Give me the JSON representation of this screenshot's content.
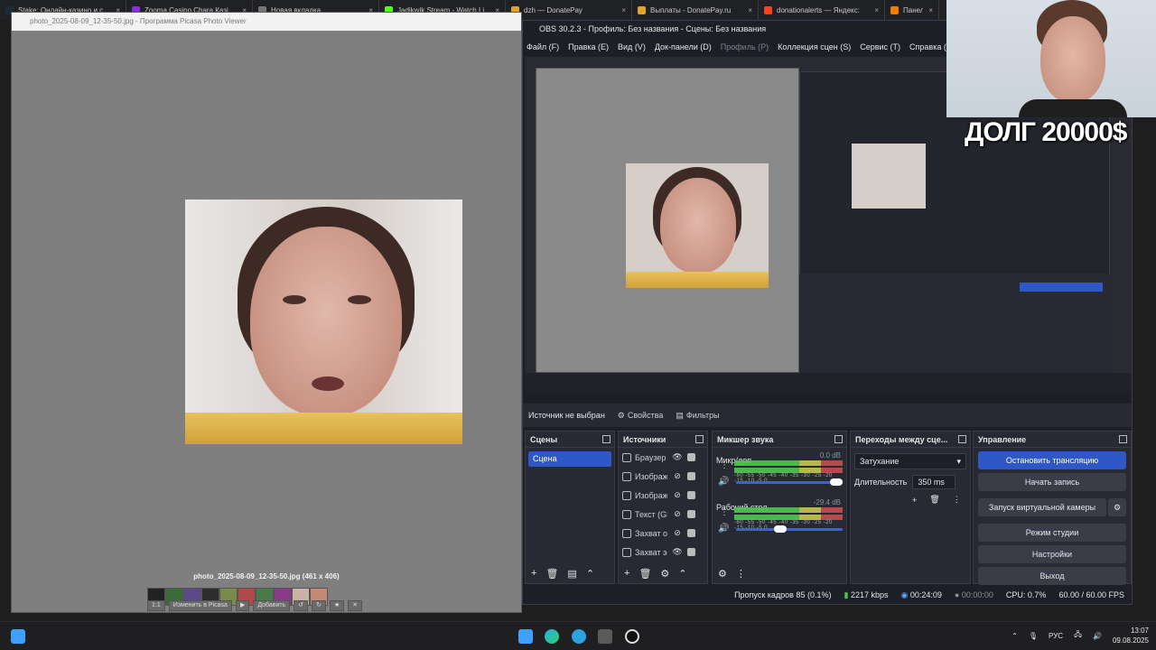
{
  "browser_tabs": [
    {
      "title": "Stake: Онлайн-казино и с",
      "color": "#1a2c38"
    },
    {
      "title": "Zooma Casino Сhara Казі",
      "color": "#8a2be2"
    },
    {
      "title": "Новая вкладка",
      "color": "#777777"
    },
    {
      "title": "Jadikwik Stream - Watch Li",
      "color": "#53fc18"
    },
    {
      "title": "dzh — DonatePay",
      "color": "#e0a32e"
    },
    {
      "title": "Выплаты - DonatePay.ru",
      "color": "#e0a32e"
    },
    {
      "title": "donationalerts — Яндекс:",
      "color": "#fc3f1d"
    },
    {
      "title": "Панель",
      "color": "#f57d00"
    }
  ],
  "picasa": {
    "title": "photo_2025-08-09_12-35-50.jpg - Программа Picasa Photo Viewer",
    "caption": "photo_2025-08-09_12-35-50.jpg (461 x 406)",
    "zoom_label": "1:1",
    "edit_button": "Изменить в Picasa",
    "add_button": "Добавить"
  },
  "obs": {
    "title": "OBS 30.2.3 - Профиль: Без названия - Сцены: Без названия",
    "menu": [
      {
        "label": "Файл (F)",
        "dim": false
      },
      {
        "label": "Правка (E)",
        "dim": false
      },
      {
        "label": "Вид (V)",
        "dim": false
      },
      {
        "label": "Док-панели (D)",
        "dim": false
      },
      {
        "label": "Профиль (P)",
        "dim": true
      },
      {
        "label": "Коллекция сцен (S)",
        "dim": false
      },
      {
        "label": "Сервис (T)",
        "dim": false
      },
      {
        "label": "Справка (H)",
        "dim": false
      }
    ],
    "source_bar": {
      "no_source": "Источник не выбран",
      "properties": "Свойства",
      "filters": "Фильтры"
    },
    "scenes": {
      "title": "Сцены",
      "items": [
        "Сцена"
      ]
    },
    "sources": {
      "title": "Источники",
      "items": [
        {
          "name": "Браузер",
          "icon": "globe-icon"
        },
        {
          "name": "Изображ",
          "icon": "image-icon"
        },
        {
          "name": "Изображ",
          "icon": "image-icon"
        },
        {
          "name": "Текст (GD",
          "icon": "text-icon"
        },
        {
          "name": "Захват о",
          "icon": "window-icon"
        },
        {
          "name": "Захват эк",
          "icon": "monitor-icon"
        }
      ]
    },
    "mixer": {
      "title": "Микшер звука",
      "channels": [
        {
          "name": "Микр/доп",
          "db": "0.0 dB",
          "level": 1.0
        },
        {
          "name": "Рабочий стол",
          "db": "-29.4 dB",
          "level": 0.4
        }
      ],
      "scale": "-60 -55 -50 -45 -40 -35 -30 -25 -20 -15 -10 -5 0"
    },
    "transitions": {
      "title": "Переходы между сце...",
      "selected": "Затухание",
      "duration_label": "Длительность",
      "duration": "350 ms"
    },
    "controls": {
      "title": "Управление",
      "stop_stream": "Остановить трансляцию",
      "start_record": "Начать запись",
      "virtual_camera": "Запуск виртуальной камеры",
      "studio_mode": "Режим студии",
      "settings": "Настройки",
      "exit": "Выход"
    },
    "status": {
      "dropped": "Пропуск кадров 85 (0.1%)",
      "bitrate": "2217 kbps",
      "stream_time": "00:24:09",
      "rec_time": "00:00:00",
      "cpu": "CPU: 0.7%",
      "fps": "60.00 / 60.00 FPS"
    }
  },
  "overlay": {
    "debt_text": "ДОЛГ 20000$"
  },
  "taskbar": {
    "lang": "РУС",
    "time": "13:07",
    "date": "09.08.2025"
  }
}
